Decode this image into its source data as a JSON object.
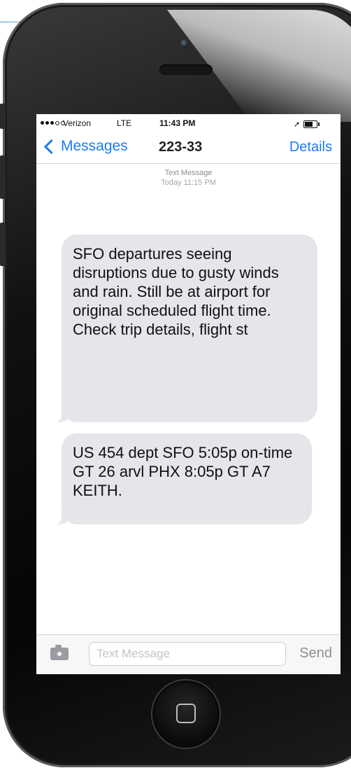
{
  "status_bar": {
    "carrier": "Verizon",
    "network": "LTE",
    "time": "11:43 PM",
    "signal_bars_filled": 3,
    "signal_bars_total": 5
  },
  "nav": {
    "back_label": "Messages",
    "title": "223-33",
    "details_label": "Details"
  },
  "thread_header": {
    "label": "Text Message",
    "timestamp": "Today 11:15 PM"
  },
  "messages": [
    {
      "text": "SFO departures seeing disruptions due to gusty winds and rain. Still be at airport for original scheduled flight time. Check trip details, flight st"
    },
    {
      "text": "US 454 dept SFO 5:05p on-time GT 26 arvl PHX 8:05p GT A7 KEITH."
    }
  ],
  "compose": {
    "placeholder": "Text Message",
    "send_label": "Send"
  },
  "colors": {
    "accent": "#1a7cf5",
    "bubble_incoming": "#e5e5ea",
    "send_disabled": "#8e8e93"
  },
  "icons": {
    "back": "chevron-left-icon",
    "camera": "camera-icon",
    "location": "location-arrow-icon",
    "battery": "battery-icon",
    "home": "home-button-icon"
  }
}
